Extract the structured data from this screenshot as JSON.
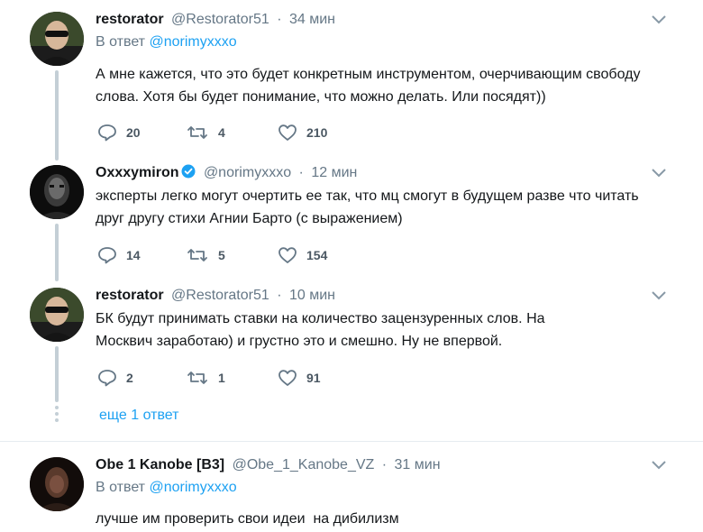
{
  "tweets": [
    {
      "name": "restorator",
      "handle": "@Restorator51",
      "time": "34 мин",
      "reply_prefix": "В ответ",
      "reply_mention": "@norimyxxxo",
      "text": "А мне кажется, что это будет конкретным инструментом, очерчивающим свободу слова. Хотя бы будет понимание, что можно делать. Или посядят))",
      "replies": "20",
      "retweets": "4",
      "likes": "210"
    },
    {
      "name": "Oxxxymiron",
      "verified": true,
      "handle": "@norimyxxxo",
      "time": "12 мин",
      "text": "эксперты легко могут очертить ее так, что мц смогут в будущем разве что читать друг другу стихи Агнии Барто (с выражением)",
      "replies": "14",
      "retweets": "5",
      "likes": "154"
    },
    {
      "name": "restorator",
      "handle": "@Restorator51",
      "time": "10 мин",
      "text": "БК будут принимать ставки на количество зацензуренных слов. На Москвич заработаю) и грустно это и смешно. Ну не впервой.",
      "replies": "2",
      "retweets": "1",
      "likes": "91"
    },
    {
      "name": "Obe 1 Kanobe [B3]",
      "handle": "@Obe_1_Kanobe_VZ",
      "time": "31 мин",
      "reply_prefix": "В ответ",
      "reply_mention": "@norimyxxxo",
      "text": "лучше им проверить свои идеи  на дибилизм"
    }
  ],
  "thread": {
    "more_replies": "еще 1 ответ"
  },
  "icons": {
    "reply": "reply-icon",
    "retweet": "retweet-icon",
    "like": "heart-icon",
    "menu": "chevron-down-icon",
    "verified": "verified-badge-icon"
  },
  "colors": {
    "accent": "#1da1f2",
    "muted": "#657786",
    "line": "#c4cfd6"
  }
}
